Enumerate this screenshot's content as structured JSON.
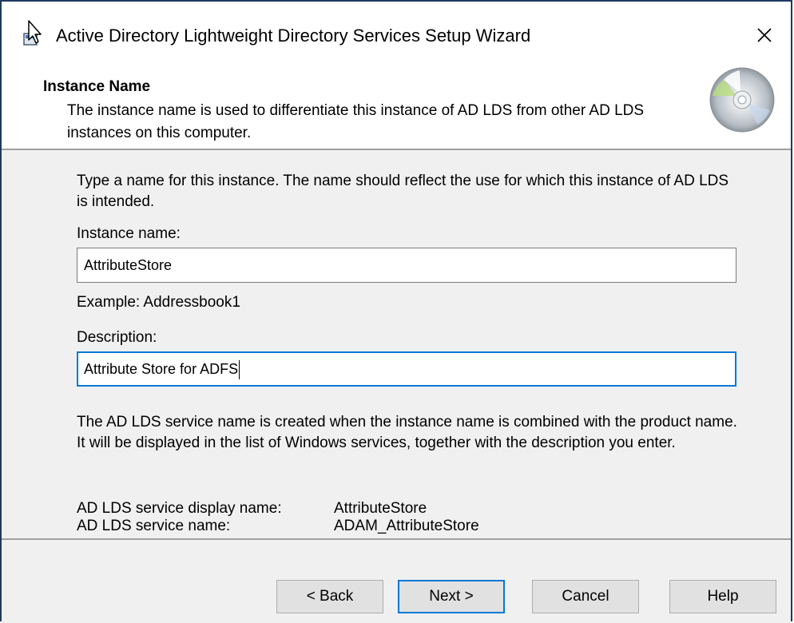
{
  "window": {
    "title": "Active Directory Lightweight Directory Services Setup Wizard"
  },
  "header": {
    "title": "Instance Name",
    "description": "The instance name is used to differentiate this instance of AD LDS from other AD LDS instances on this computer."
  },
  "form": {
    "intro": "Type a name for this instance. The name should reflect the use for which this instance of AD LDS is intended.",
    "instance_name_label": "Instance name:",
    "instance_name_value": "AttributeStore",
    "example": "Example: Addressbook1",
    "description_label": "Description:",
    "description_value": "Attribute Store for ADFS",
    "service_info": "The AD LDS service name is created when the instance name is combined with the product name. It will be displayed in the list of Windows services, together with the description you enter.",
    "display_name_label": "AD LDS service display name:",
    "display_name_value": "AttributeStore",
    "service_name_label": "AD LDS service name:",
    "service_name_value": "ADAM_AttributeStore"
  },
  "buttons": {
    "back": "< Back",
    "next": "Next >",
    "cancel": "Cancel",
    "help": "Help"
  },
  "icons": {
    "app": "wizard-app-icon",
    "close": "close-icon",
    "header": "cd-disc-icon"
  },
  "colors": {
    "focus_border": "#0078d7",
    "content_background": "#f0f0f0"
  }
}
